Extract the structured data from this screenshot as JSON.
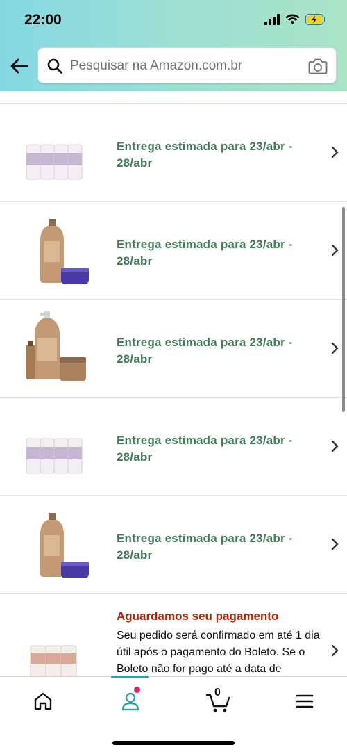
{
  "status_bar": {
    "time": "22:00"
  },
  "search": {
    "placeholder": "Pesquisar na Amazon.com.br"
  },
  "orders": [
    {
      "product": "ampoules-4",
      "delivery": "Entrega estimada para 23/abr - 28/abr"
    },
    {
      "product": "shampoo-mask",
      "delivery": "Entrega estimada para 23/abr - 28/abr"
    },
    {
      "product": "kit-pump-oil-mask",
      "delivery": "Entrega estimada para 23/abr - 28/abr"
    },
    {
      "product": "ampoules-4",
      "delivery": "Entrega estimada para 23/abr - 28/abr"
    },
    {
      "product": "shampoo-mask",
      "delivery": "Entrega estimada para 23/abr - 28/abr"
    }
  ],
  "pending": {
    "title": "Aguardamos seu pagamento",
    "description": "Seu pedido será confirmado em até 1 dia útil após o pagamento do Boleto. Se o Boleto não for pago até a data de"
  },
  "bottom_nav": {
    "items": [
      "home-icon",
      "account-icon",
      "cart-icon",
      "menu-icon"
    ],
    "cart_count": "0"
  },
  "colors": {
    "header_gradient": [
      "#84d8e2",
      "#a9e4c6"
    ],
    "delivery_green": "#3d7d56",
    "pending_red": "#b12704",
    "nav_accent": "#31a3a8",
    "notification_dot": "#d6246e"
  }
}
